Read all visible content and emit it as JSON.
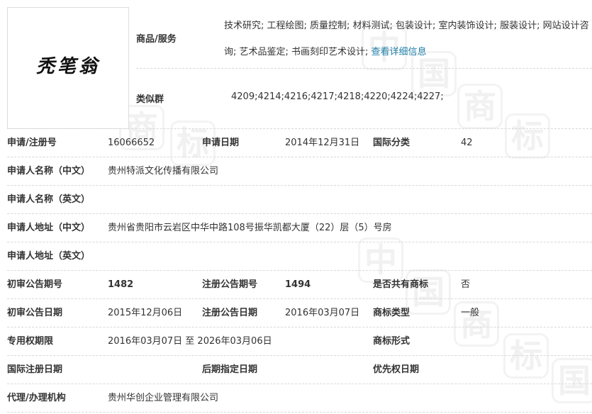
{
  "logo": {
    "text": "秃笔翁"
  },
  "goods": {
    "label": "商品/服务",
    "text": "技术研究; 工程绘图; 质量控制; 材料测试; 包装设计; 室内装饰设计; 服装设计; 网站设计咨询; 艺术品鉴定; 书画刻印艺术设计;",
    "link": "查看详细信息"
  },
  "similar": {
    "label": "类似群",
    "value": "4209;4214;4216;4217;4218;4220;4224;4227;"
  },
  "rows": [
    {
      "c1": "申请/注册号",
      "v1": "16066652",
      "c2": "申请日期",
      "v2": "2014年12月31日",
      "c3": "国际分类",
      "v3": "42"
    },
    {
      "c1": "申请人名称（中文）",
      "v1": "贵州特派文化传播有限公司"
    },
    {
      "c1": "申请人名称（英文）",
      "v1": ""
    },
    {
      "c1": "申请人地址（中文）",
      "v1": "贵州省贵阳市云岩区中华中路108号振华凯都大厦（22）层（5）号房"
    },
    {
      "c1": "申请人地址（英文）",
      "v1": ""
    },
    {
      "c1": "初审公告期号",
      "v1": "1482",
      "c2": "注册公告期号",
      "v2": "1494",
      "c3": "是否共有商标",
      "v3": "否"
    },
    {
      "c1": "初审公告日期",
      "v1": "2015年12月06日",
      "c2": "注册公告日期",
      "v2": "2016年03月07日",
      "c3": "商标类型",
      "v3": "一般"
    },
    {
      "c1": "专用权期限",
      "v1": "2016年03月07日 至 2026年03月06日",
      "c3": "商标形式",
      "v3": ""
    },
    {
      "c1": "国际注册日期",
      "v1": "",
      "c2": "后期指定日期",
      "v2": "",
      "c3": "优先权日期",
      "v3": ""
    },
    {
      "c1": "代理/办理机构",
      "v1": "贵州华创企业管理有限公司"
    }
  ],
  "watermark": [
    "中",
    "国",
    "商",
    "标"
  ]
}
